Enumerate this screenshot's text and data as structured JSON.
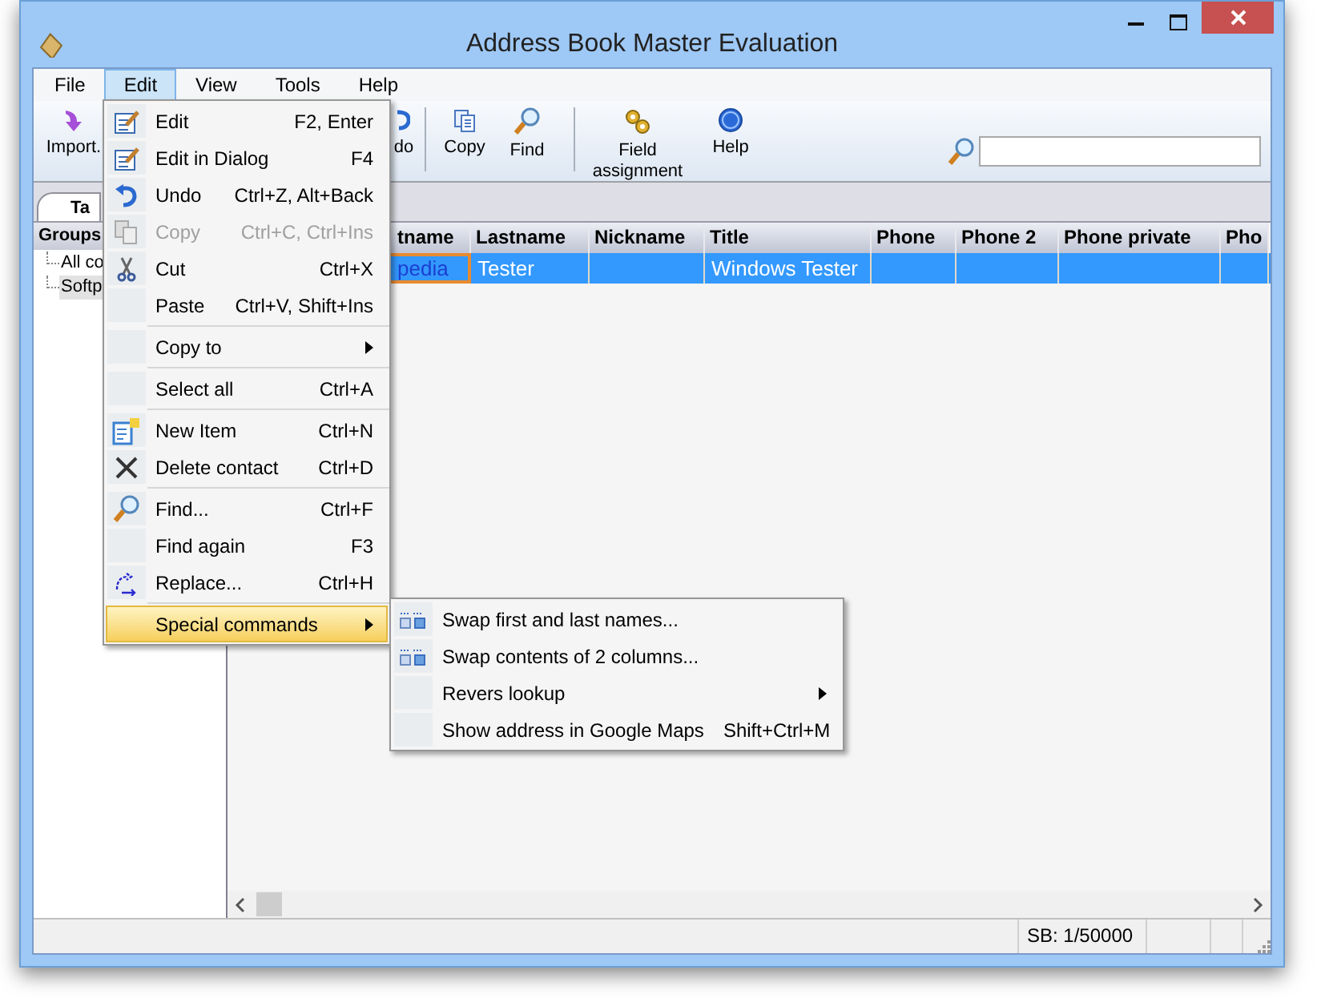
{
  "window": {
    "title": "Address Book Master Evaluation"
  },
  "menu_bar": [
    {
      "label": "File",
      "selected": false
    },
    {
      "label": "Edit",
      "selected": true
    },
    {
      "label": "View",
      "selected": false
    },
    {
      "label": "Tools",
      "selected": false
    },
    {
      "label": "Help",
      "selected": false
    }
  ],
  "toolbar": [
    {
      "label": "Import."
    },
    {
      "label": "do"
    },
    {
      "label": "Copy"
    },
    {
      "label": "Find"
    },
    {
      "label": "Field assignment"
    },
    {
      "label": "Help"
    }
  ],
  "tabs": [
    {
      "label": "Ta",
      "selected": true
    }
  ],
  "groups": {
    "header": "Groups",
    "items": [
      {
        "label": "All co",
        "selected": false
      },
      {
        "label": "Softp",
        "selected": true
      }
    ]
  },
  "table": {
    "columns": [
      "tname",
      "Lastname",
      "Nickname",
      "Title",
      "Phone",
      "Phone 2",
      "Phone private",
      "Pho"
    ],
    "rows": [
      {
        "selected": true,
        "cells": [
          "pedia",
          "Tester",
          null,
          "Windows Tester",
          null,
          null,
          null,
          null
        ]
      }
    ]
  },
  "edit_menu": [
    {
      "kind": "item",
      "label": "Edit",
      "shortcut": "F2, Enter",
      "disabled": false
    },
    {
      "kind": "item",
      "label": "Edit in Dialog",
      "shortcut": "F4",
      "disabled": false
    },
    {
      "kind": "item",
      "label": "Undo",
      "shortcut": "Ctrl+Z, Alt+Back",
      "disabled": false
    },
    {
      "kind": "item",
      "label": "Copy",
      "shortcut": "Ctrl+C, Ctrl+Ins",
      "disabled": true
    },
    {
      "kind": "item",
      "label": "Cut",
      "shortcut": "Ctrl+X",
      "disabled": false
    },
    {
      "kind": "item",
      "label": "Paste",
      "shortcut": "Ctrl+V, Shift+Ins",
      "disabled": false
    },
    {
      "kind": "separator"
    },
    {
      "kind": "submenu",
      "label": "Copy to",
      "selected": false
    },
    {
      "kind": "separator"
    },
    {
      "kind": "item",
      "label": "Select all",
      "shortcut": "Ctrl+A",
      "disabled": false
    },
    {
      "kind": "separator"
    },
    {
      "kind": "item",
      "label": "New Item",
      "shortcut": "Ctrl+N",
      "disabled": false
    },
    {
      "kind": "item",
      "label": "Delete contact",
      "shortcut": "Ctrl+D",
      "disabled": false
    },
    {
      "kind": "separator"
    },
    {
      "kind": "item",
      "label": "Find...",
      "shortcut": "Ctrl+F",
      "disabled": false
    },
    {
      "kind": "item",
      "label": "Find again",
      "shortcut": "F3",
      "disabled": false
    },
    {
      "kind": "item",
      "label": "Replace...",
      "shortcut": "Ctrl+H",
      "disabled": false
    },
    {
      "kind": "separator"
    },
    {
      "kind": "submenu",
      "label": "Special commands",
      "selected": true
    }
  ],
  "special_submenu": [
    {
      "kind": "item",
      "label": "Swap first and last names..."
    },
    {
      "kind": "item",
      "label": "Swap contents of 2 columns..."
    },
    {
      "kind": "submenu",
      "label": "Revers lookup"
    },
    {
      "kind": "item",
      "label": "Show address in Google Maps",
      "shortcut": "Shift+Ctrl+M"
    }
  ],
  "status_bar": {
    "text": "SB: 1/50000"
  }
}
